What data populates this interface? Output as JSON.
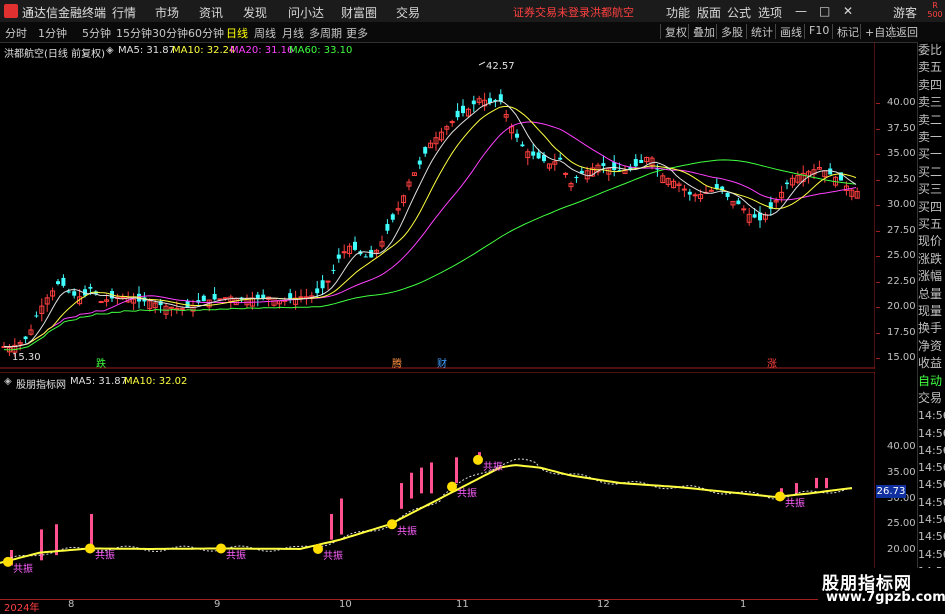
{
  "titlebar": {
    "app_name": "通达信金融终端",
    "menus": [
      "行情",
      "市场",
      "资讯",
      "发现",
      "问小达",
      "财富圈",
      "交易"
    ],
    "warning": "证券交易未登录",
    "stock_name": "洪都航空",
    "right_menus": [
      "功能",
      "版面",
      "公式",
      "选项"
    ],
    "window_controls": [
      "—",
      "□",
      "✕"
    ],
    "guest": "游客",
    "corner_badge": "R 500"
  },
  "toolbar": {
    "periods": [
      "分时",
      "1分钟",
      "5分钟",
      "15分钟",
      "30分钟",
      "60分钟",
      "日线",
      "周线",
      "月线",
      "多周期",
      "更多"
    ],
    "active_period": "日线",
    "right_buttons": [
      "复权",
      "叠加",
      "多股",
      "统计",
      "画线",
      "F10",
      "标记",
      "+自选",
      "返回"
    ]
  },
  "main_chart": {
    "title": "洪都航空(日线 前复权)",
    "legend": [
      {
        "label": "MA5: 31.87",
        "color": "#e0e0e0"
      },
      {
        "label": "MA10: 32.24",
        "color": "#ffff40"
      },
      {
        "label": "MA20: 31.16",
        "color": "#ff40ff"
      },
      {
        "label": "MA60: 33.10",
        "color": "#40ff40"
      }
    ],
    "y_ticks": [
      "40.00",
      "37.50",
      "35.00",
      "32.50",
      "30.00",
      "27.50",
      "25.00",
      "22.50",
      "20.00",
      "17.50",
      "15.00"
    ],
    "high_label": "42.57",
    "low_label": "15.30",
    "markers": [
      "跌",
      "腾",
      "财",
      "涨"
    ]
  },
  "indicator_chart": {
    "title": "股朋指标网",
    "legend": [
      {
        "label": "MA5: 31.87",
        "color": "#e0e0e0"
      },
      {
        "label": "MA10: 32.02",
        "color": "#ffff40"
      }
    ],
    "y_ticks": [
      "40.00",
      "35.00",
      "30.00",
      "25.00",
      "20.00"
    ],
    "current_value": "26.73",
    "signal_label": "共振"
  },
  "x_axis": {
    "labels": [
      "2024年",
      "8",
      "9",
      "10",
      "11",
      "12",
      "1"
    ]
  },
  "right_panel": {
    "items": [
      "委比",
      "卖五",
      "卖四",
      "卖三",
      "卖二",
      "卖一",
      "买一",
      "买二",
      "买三",
      "买四",
      "买五",
      "现价",
      "涨跌",
      "涨幅",
      "总量",
      "现量",
      "换手",
      "净资",
      "收益",
      "自动",
      "交易",
      "14:56",
      "14:56",
      "14:56",
      "14:56",
      "14:56",
      "14:56",
      "14:56",
      "14:56",
      "14:56",
      "14:56",
      "14:56"
    ]
  },
  "watermark": {
    "name": "股朋指标网",
    "url": "www.7gpzb.com"
  },
  "colors": {
    "up": "#ff4040",
    "down": "#40ffff",
    "ma5": "#e0e0e0",
    "ma10": "#ffff40",
    "ma20": "#ff40ff",
    "ma60": "#40ff40",
    "signal": "#ffdd00"
  }
}
